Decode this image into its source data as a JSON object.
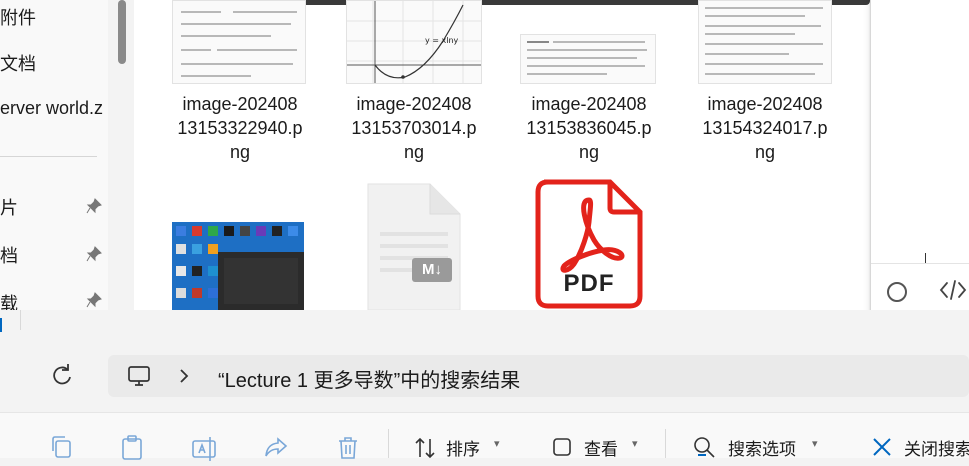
{
  "sidebar": {
    "items": [
      {
        "label": "附件",
        "pinned": false
      },
      {
        "label": "文档",
        "pinned": false
      },
      {
        "label": "erver world.z",
        "pinned": false
      },
      {
        "label": "片",
        "pinned": true
      },
      {
        "label": "档",
        "pinned": true
      },
      {
        "label": "载",
        "pinned": true
      }
    ]
  },
  "files": [
    {
      "name_line1": "image-202408",
      "name_line2": "13153322940.p",
      "name_line3": "ng",
      "kind": "image"
    },
    {
      "name_line1": "image-202408",
      "name_line2": "13153703014.p",
      "name_line3": "ng",
      "kind": "image"
    },
    {
      "name_line1": "image-202408",
      "name_line2": "13153836045.p",
      "name_line3": "ng",
      "kind": "image"
    },
    {
      "name_line1": "image-202408",
      "name_line2": "13154324017.p",
      "name_line3": "ng",
      "kind": "image"
    },
    {
      "kind": "screenshot-image"
    },
    {
      "kind": "markdown-file",
      "badge": "M↓"
    },
    {
      "kind": "pdf-file",
      "badge": "PDF"
    }
  ],
  "thumb_texts": {
    "graph_label": "y = xlny"
  },
  "addressbar": {
    "location_text": "“Lecture 1 更多导数”中的搜索结果"
  },
  "toolbar": {
    "sort_label": "排序",
    "view_label": "查看",
    "search_options_label": "搜索选项",
    "close_search_label": "关闭搜索"
  },
  "colors": {
    "accent": "#0067c0",
    "pdf_red": "#e3231b",
    "icon_blue": "#7aa7d8"
  }
}
